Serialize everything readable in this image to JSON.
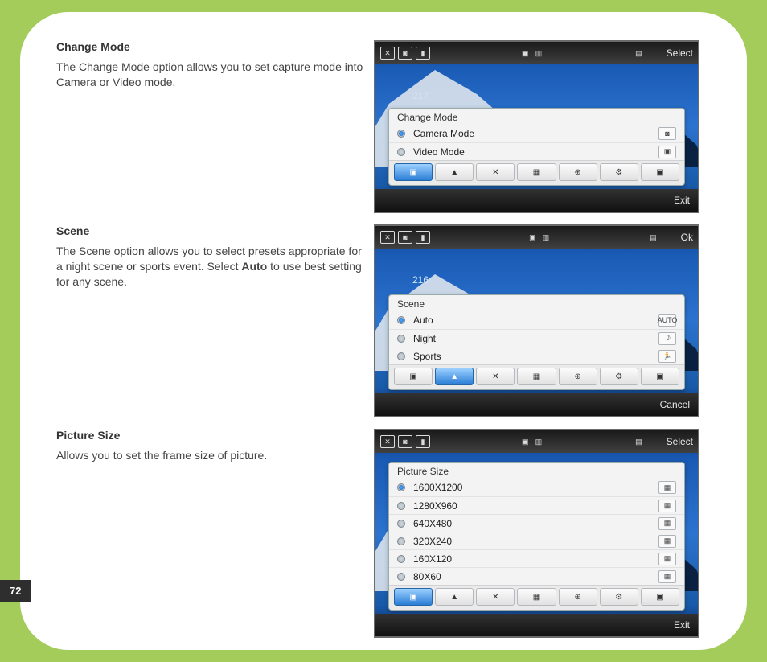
{
  "page_number": "72",
  "sections": [
    {
      "title": "Change Mode",
      "body_before_bold": "The Change Mode option allows you to set capture mode into Camera or Video mode.",
      "bold_word": "",
      "body_after_bold": ""
    },
    {
      "title": "Scene",
      "body_before_bold": "The Scene option allows you to select presets appropriate for a night scene or sports event. Select ",
      "bold_word": "Auto",
      "body_after_bold": " to use best setting for any scene."
    },
    {
      "title": "Picture Size",
      "body_before_bold": "Allows you to set the frame size of picture.",
      "bold_word": "",
      "body_after_bold": ""
    }
  ],
  "screens": {
    "change_mode": {
      "top_right": "Select",
      "bottom_right": "Exit",
      "counter": "217",
      "panel_title": "Change Mode",
      "items": [
        {
          "label": "Camera Mode",
          "selected": true,
          "trail": "◙"
        },
        {
          "label": "Video Mode",
          "selected": false,
          "trail": "▣"
        }
      ],
      "toolbar_active_index": 0
    },
    "scene": {
      "top_right": "Ok",
      "bottom_right": "Cancel",
      "counter": "216",
      "panel_title": "Scene",
      "items": [
        {
          "label": "Auto",
          "selected": true,
          "trail": "AUTO"
        },
        {
          "label": "Night",
          "selected": false,
          "trail": "☽"
        },
        {
          "label": "Sports",
          "selected": false,
          "trail": "🏃"
        }
      ],
      "toolbar_active_index": 1
    },
    "picture_size": {
      "top_right": "Select",
      "bottom_right": "Exit",
      "counter": "",
      "panel_title": "Picture Size",
      "items": [
        {
          "label": "1600X1200",
          "selected": true,
          "trail": "▦"
        },
        {
          "label": "1280X960",
          "selected": false,
          "trail": "▦"
        },
        {
          "label": "640X480",
          "selected": false,
          "trail": "▦"
        },
        {
          "label": "320X240",
          "selected": false,
          "trail": "▦"
        },
        {
          "label": "160X120",
          "selected": false,
          "trail": "▦"
        },
        {
          "label": "80X60",
          "selected": false,
          "trail": "▦"
        }
      ],
      "toolbar_active_index": 0
    }
  },
  "toolbar_glyphs": [
    "▣",
    "▲",
    "✕",
    "▦",
    "⊕",
    "⚙",
    "▣"
  ],
  "topbar": {
    "left_glyphs": [
      "✕",
      "◙",
      "▮"
    ],
    "mid_glyphs": [
      "▣",
      "▥"
    ],
    "right_glyph": "▤"
  }
}
